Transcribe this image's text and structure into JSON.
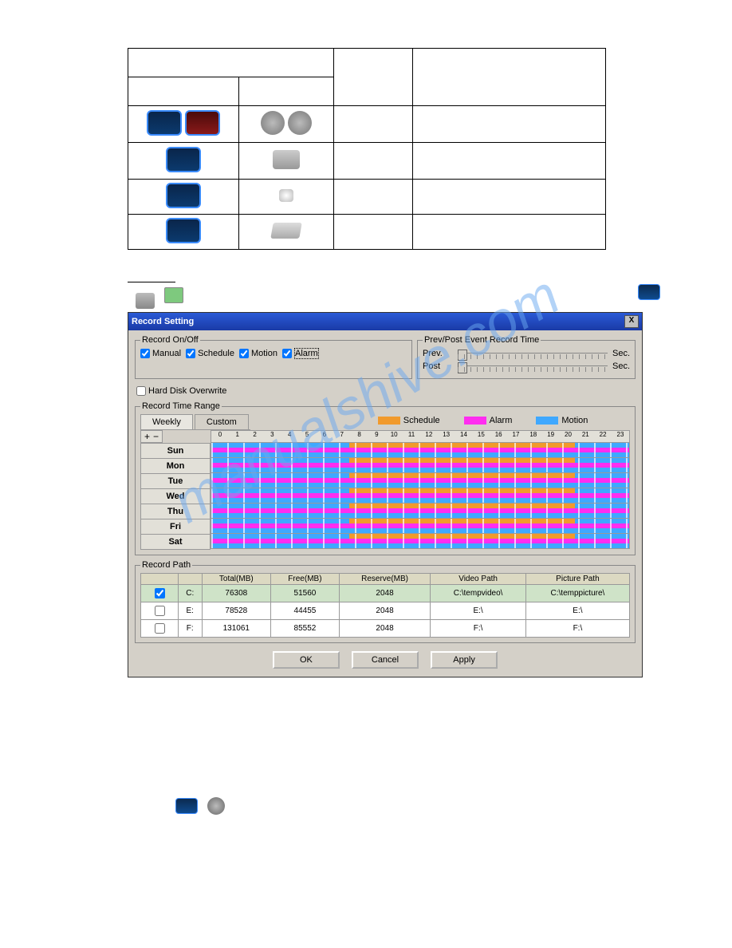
{
  "watermark": "manualshive.com",
  "window": {
    "title": "Record Setting",
    "record_on_off": {
      "legend": "Record On/Off",
      "options": [
        {
          "label": "Manual",
          "checked": true
        },
        {
          "label": "Schedule",
          "checked": true
        },
        {
          "label": "Motion",
          "checked": true
        },
        {
          "label": "Alarm",
          "checked": true,
          "boxed": true
        }
      ]
    },
    "prevpost": {
      "legend": "Prev/Post Event Record Time",
      "prev_label": "Prev.",
      "post_label": "Post",
      "sec_label": "Sec."
    },
    "hdd_overwrite": {
      "label": "Hard Disk Overwrite",
      "checked": false
    },
    "range": {
      "legend": "Record Time Range",
      "tabs": [
        "Weekly",
        "Custom"
      ],
      "active_tab": 0,
      "legend_items": [
        {
          "label": "Schedule",
          "class": "sw-sched"
        },
        {
          "label": "Alarm",
          "class": "sw-alarm"
        },
        {
          "label": "Motion",
          "class": "sw-motion"
        }
      ],
      "plus": "+",
      "minus": "−",
      "days": [
        "Sun",
        "Mon",
        "Tue",
        "Wed",
        "Thu",
        "Fri",
        "Sat"
      ],
      "hours": [
        "0",
        "1",
        "2",
        "3",
        "4",
        "5",
        "6",
        "7",
        "8",
        "9",
        "10",
        "11",
        "12",
        "13",
        "14",
        "15",
        "16",
        "17",
        "18",
        "19",
        "20",
        "21",
        "22",
        "23"
      ],
      "sched_start_pct": 33,
      "sched_end_pct": 87
    },
    "record_path": {
      "legend": "Record Path",
      "headers": [
        "",
        "",
        "Total(MB)",
        "Free(MB)",
        "Reserve(MB)",
        "Video Path",
        "Picture Path"
      ],
      "rows": [
        {
          "checked": true,
          "drive": "C:",
          "total": "76308",
          "free": "51560",
          "reserve": "2048",
          "video": "C:\\tempvideo\\",
          "picture": "C:\\temppicture\\",
          "sel": true
        },
        {
          "checked": false,
          "drive": "E:",
          "total": "78528",
          "free": "44455",
          "reserve": "2048",
          "video": "E:\\",
          "picture": "E:\\",
          "sel": false
        },
        {
          "checked": false,
          "drive": "F:",
          "total": "131061",
          "free": "85552",
          "reserve": "2048",
          "video": "F:\\",
          "picture": "F:\\",
          "sel": false
        }
      ]
    },
    "buttons": {
      "ok": "OK",
      "cancel": "Cancel",
      "apply": "Apply"
    }
  }
}
